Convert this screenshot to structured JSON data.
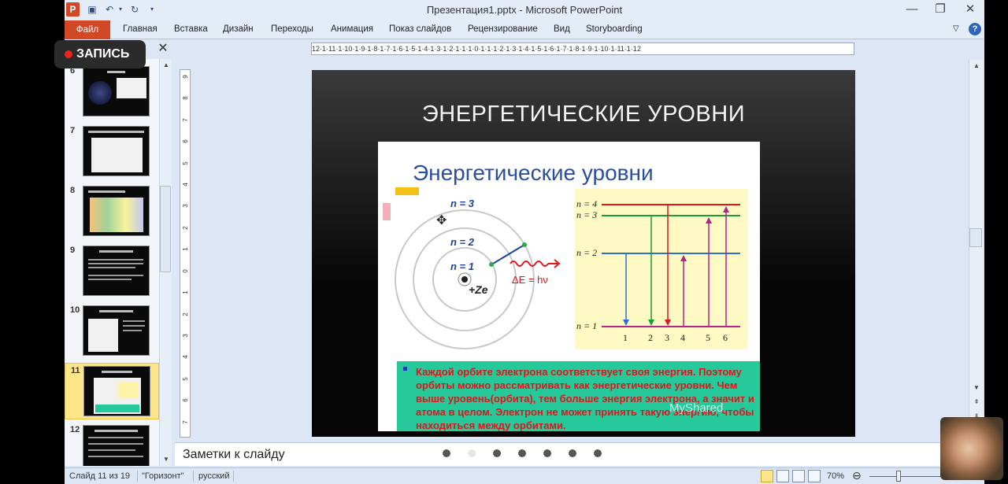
{
  "window": {
    "title": "Презентация1.pptx - Microsoft PowerPoint",
    "app_logo": "P"
  },
  "ribbon": {
    "file_tab": "Файл",
    "tabs": [
      "Главная",
      "Вставка",
      "Дизайн",
      "Переходы",
      "Анимация",
      "Показ слайдов",
      "Рецензирование",
      "Вид",
      "Storyboarding"
    ]
  },
  "recording": {
    "label": "ЗАПИСЬ"
  },
  "thumbnails": [
    {
      "num": "6"
    },
    {
      "num": "7"
    },
    {
      "num": "8"
    },
    {
      "num": "9"
    },
    {
      "num": "10"
    },
    {
      "num": "11",
      "selected": true
    },
    {
      "num": "12"
    }
  ],
  "ruler": {
    "horizontal": "12·1·11·1·10·1·9·1·8·1·7·1·6·1·5·1·4·1·3·1·2·1·1·1·0·1·1·1·2·1·3·1·4·1·5·1·6·1·7·1·8·1·9·1·10·1·11·1·12",
    "vertical": [
      "9",
      "8",
      "7",
      "6",
      "5",
      "4",
      "3",
      "2",
      "1",
      "0",
      "1",
      "2",
      "3",
      "4",
      "5",
      "6",
      "7"
    ]
  },
  "slide": {
    "title": "ЭНЕРГЕТИЧЕСКИЕ УРОВНИ",
    "picture": {
      "heading": "Энергетические уровни",
      "orbits": [
        "n = 3",
        "n = 2",
        "n = 1"
      ],
      "nucleus": "+Ze",
      "photon": "ΔE = hν",
      "levels": [
        "n = 4",
        "n = 3",
        "n = 2",
        "n = 1"
      ],
      "transitions": [
        "1",
        "2",
        "3",
        "4",
        "5",
        "6"
      ],
      "info": "Каждой орбите электрона соответствует своя энергия. Поэтому орбиты можно рассматривать как энергетические уровни. Чем выше уровень(орбита), тем больше энергия электрона, а значит и атома в целом. Электрон не может принять такую энергию, чтобы находиться между орбитами.",
      "watermark": "MyShared"
    }
  },
  "notes": {
    "placeholder": "Заметки к слайду"
  },
  "status": {
    "slide": "Слайд 11 из 19",
    "theme": "\"Горизонт\"",
    "language": "русский",
    "zoom": "70%",
    "zoom_level": 0.7
  },
  "colors": {
    "file_tab": "#d24726",
    "heading_blue": "#2a4ea0",
    "info_green": "#26c99a",
    "info_red": "#e2131b",
    "level_box": "#fff9c4",
    "thumb_selected": "#fce689"
  }
}
